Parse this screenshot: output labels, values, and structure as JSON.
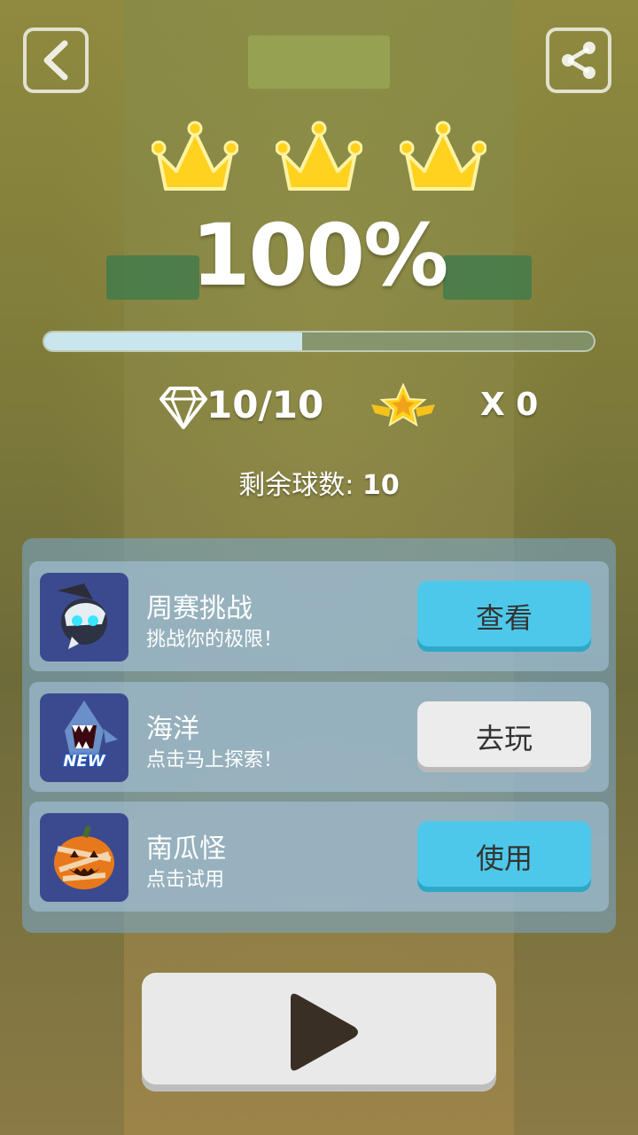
{
  "header": {
    "back_icon": "back-arrow-icon",
    "share_icon": "share-icon"
  },
  "result": {
    "crowns": 3,
    "percent": "100%",
    "progress": 0.47
  },
  "stats": {
    "gems": "10/10",
    "stars": "X 0"
  },
  "remaining": {
    "label": "剩余球数:",
    "value": "10"
  },
  "rows": [
    {
      "title": "周赛挑战",
      "subtitle": "挑战你的极限！",
      "button": "查看",
      "icon": "robot-ball-icon"
    },
    {
      "title": "海洋",
      "subtitle": "点击马上探索！",
      "button": "去玩",
      "icon": "shark-icon",
      "badge": "NEW"
    },
    {
      "title": "南瓜怪",
      "subtitle": "点击试用",
      "button": "使用",
      "icon": "pumpkin-icon"
    }
  ],
  "play": {
    "icon": "play-icon"
  },
  "colors": {
    "accent_blue": "#4ec8ea",
    "crown": "#ffd21f"
  }
}
